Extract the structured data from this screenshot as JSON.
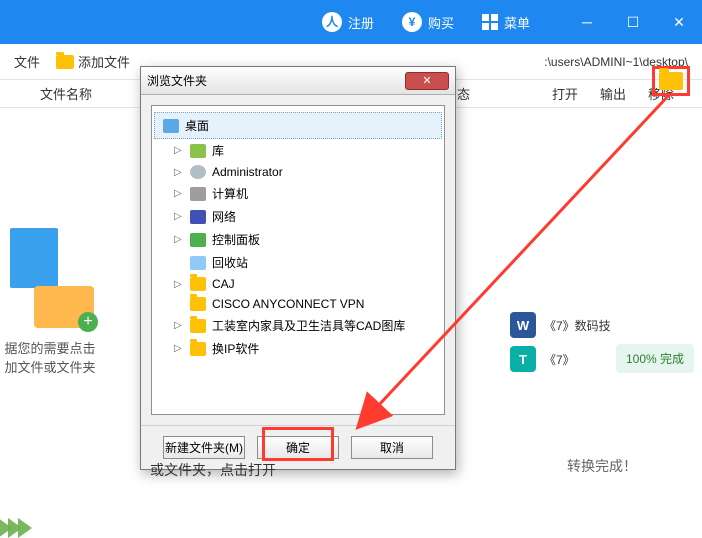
{
  "titlebar": {
    "register": "注册",
    "buy": "购买",
    "menu": "菜单"
  },
  "toolbar": {
    "file_menu": "文件",
    "add_file": "添加文件",
    "path": ":\\users\\ADMINI~1\\desktop\\"
  },
  "headers": {
    "filename": "文件名称",
    "status": "态",
    "open": "打开",
    "export": "输出",
    "remove": "移除"
  },
  "dropzone": {
    "line1": "据您的需要点击",
    "line2": "加文件或文件夹"
  },
  "dialog": {
    "title": "浏览文件夹",
    "root": "桌面",
    "items": [
      {
        "icon": "i-lib",
        "label": "库",
        "expandable": true
      },
      {
        "icon": "i-user",
        "label": "Administrator",
        "expandable": true
      },
      {
        "icon": "i-computer",
        "label": "计算机",
        "expandable": true
      },
      {
        "icon": "i-network",
        "label": "网络",
        "expandable": true
      },
      {
        "icon": "i-cp",
        "label": "控制面板",
        "expandable": true
      },
      {
        "icon": "i-recycle",
        "label": "回收站",
        "expandable": false
      },
      {
        "icon": "i-folder",
        "label": "CAJ",
        "expandable": true
      },
      {
        "icon": "i-folder",
        "label": "CISCO ANYCONNECT VPN",
        "expandable": false
      },
      {
        "icon": "i-folder",
        "label": "工装室内家具及卫生洁具等CAD图库",
        "expandable": true
      },
      {
        "icon": "i-folder",
        "label": "换IP软件",
        "expandable": true
      }
    ],
    "new_folder": "新建文件夹(M)",
    "ok": "确定",
    "cancel": "取消"
  },
  "results": {
    "item1": "《7》数码技",
    "item2": "《7》",
    "progress": "100% 完成",
    "footer": "转换完成！"
  },
  "below": "或文件夹，点击打开"
}
